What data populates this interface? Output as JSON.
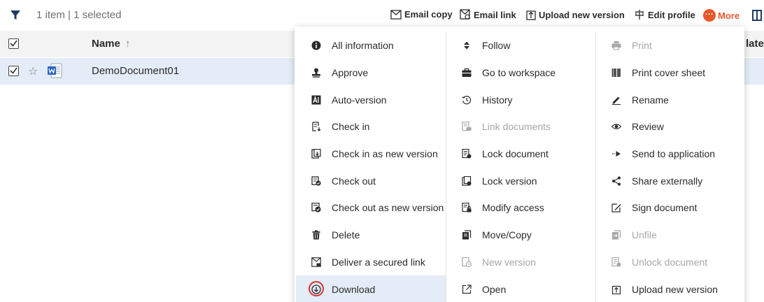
{
  "toolbar": {
    "count_text": "1 item | 1 selected",
    "email_copy": "Email copy",
    "email_link": "Email link",
    "upload_new_version": "Upload new version",
    "edit_profile": "Edit profile",
    "more": "More",
    "more_dots": "···",
    "accent_color": "#e8572c"
  },
  "table": {
    "col_name": "Name",
    "sort_arrow": "↑",
    "col_date_partial": "late",
    "rows": [
      {
        "name": "DemoDocument01",
        "selected": true,
        "icon": "word-document-icon"
      }
    ]
  },
  "menu": {
    "columns": [
      [
        {
          "label": "All information",
          "icon": "info-icon"
        },
        {
          "label": "Approve",
          "icon": "approve-stamp-icon"
        },
        {
          "label": "Auto-version",
          "icon": "auto-version-icon"
        },
        {
          "label": "Check in",
          "icon": "check-in-icon"
        },
        {
          "label": "Check in as new version",
          "icon": "check-in-new-version-icon"
        },
        {
          "label": "Check out",
          "icon": "check-out-icon"
        },
        {
          "label": "Check out as new version",
          "icon": "check-out-new-version-icon"
        },
        {
          "label": "Delete",
          "icon": "trash-icon"
        },
        {
          "label": "Deliver a secured link",
          "icon": "secured-link-icon"
        },
        {
          "label": "Download",
          "icon": "download-icon"
        }
      ],
      [
        {
          "label": "Follow",
          "icon": "follow-icon"
        },
        {
          "label": "Go to workspace",
          "icon": "briefcase-icon"
        },
        {
          "label": "History",
          "icon": "history-icon"
        },
        {
          "label": "Link documents",
          "icon": "link-documents-icon"
        },
        {
          "label": "Lock document",
          "icon": "lock-document-icon"
        },
        {
          "label": "Lock version",
          "icon": "lock-version-icon"
        },
        {
          "label": "Modify access",
          "icon": "modify-access-icon"
        },
        {
          "label": "Move/Copy",
          "icon": "move-copy-icon"
        },
        {
          "label": "New version",
          "icon": "new-version-icon"
        },
        {
          "label": "Open",
          "icon": "open-external-icon"
        }
      ],
      [
        {
          "label": "Print",
          "icon": "printer-icon"
        },
        {
          "label": "Print cover sheet",
          "icon": "barcode-icon"
        },
        {
          "label": "Rename",
          "icon": "pencil-icon"
        },
        {
          "label": "Review",
          "icon": "eye-icon"
        },
        {
          "label": "Send to application",
          "icon": "send-icon"
        },
        {
          "label": "Share externally",
          "icon": "share-icon"
        },
        {
          "label": "Sign document",
          "icon": "sign-icon"
        },
        {
          "label": "Unfile",
          "icon": "unfile-icon"
        },
        {
          "label": "Unlock document",
          "icon": "unlock-document-icon"
        },
        {
          "label": "Upload new version",
          "icon": "upload-icon"
        }
      ]
    ],
    "disabled": [
      "Print",
      "Link documents",
      "New version",
      "Unfile",
      "Unlock document"
    ],
    "highlighted": "Download",
    "highlight_color": "#e3ecf7",
    "ring_color": "#d9342b"
  }
}
